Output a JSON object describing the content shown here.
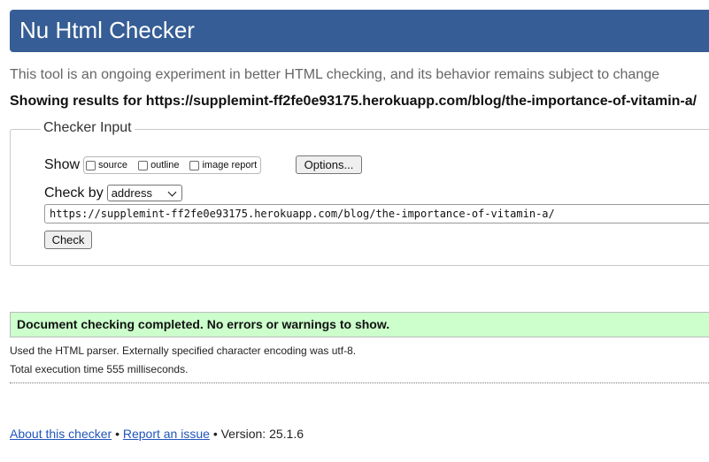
{
  "header": {
    "title": "Nu Html Checker"
  },
  "tagline": "This tool is an ongoing experiment in better HTML checking, and its behavior remains subject to change",
  "results_heading": "Showing results for https://supplemint-ff2fe0e93175.herokuapp.com/blog/the-importance-of-vitamin-a/",
  "checker_input": {
    "legend": "Checker Input",
    "show_label": "Show",
    "show_options": [
      {
        "label": "source",
        "checked": false
      },
      {
        "label": "outline",
        "checked": false
      },
      {
        "label": "image report",
        "checked": false
      }
    ],
    "options_button": "Options...",
    "check_by_label": "Check by",
    "check_by_value": "address",
    "url_value": "https://supplemint-ff2fe0e93175.herokuapp.com/blog/the-importance-of-vitamin-a/",
    "check_button": "Check"
  },
  "result": {
    "message": "Document checking completed. No errors or warnings to show.",
    "parser_info": "Used the HTML parser. Externally specified character encoding was utf-8.",
    "execution_time": "Total execution time 555 milliseconds."
  },
  "footer": {
    "about_link": "About this checker",
    "separator": "•",
    "report_link": "Report an issue",
    "version": "Version: 25.1.6"
  },
  "colors": {
    "banner": "#365d95",
    "success_bg": "#ccffcc",
    "link": "#2255bb"
  }
}
